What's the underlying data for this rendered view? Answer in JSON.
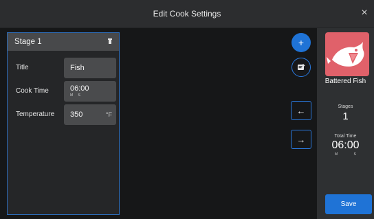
{
  "header": {
    "title": "Edit Cook Settings",
    "close_icon": "×"
  },
  "stage": {
    "title": "Stage 1",
    "fields": {
      "title_label": "Title",
      "title_value": "Fish",
      "cook_time_label": "Cook Time",
      "cook_time_value": "06:00",
      "cook_time_units": "M S",
      "temperature_label": "Temperature",
      "temperature_value": "350",
      "temperature_unit": "°F"
    }
  },
  "actions": {
    "add_symbol": "+",
    "prev_symbol": "←",
    "next_symbol": "→"
  },
  "sidebar": {
    "recipe_name": "Battered Fish",
    "stages_label": "Stages",
    "stages_value": "1",
    "total_time_label": "Total Time",
    "total_time_value": "06:00",
    "total_time_units": "M S",
    "save_label": "Save"
  },
  "colors": {
    "accent": "#1f73d6",
    "thumb_bg": "#e0616a"
  },
  "icons": {
    "add": "plus-icon",
    "notes": "notes-icon",
    "delete": "trash-icon",
    "prev": "arrow-left-icon",
    "next": "arrow-right-icon",
    "recipe": "fish-icon"
  }
}
